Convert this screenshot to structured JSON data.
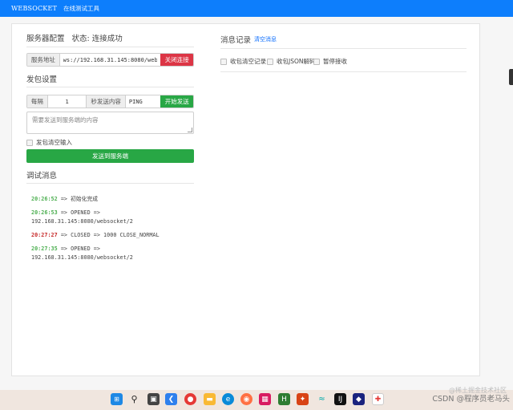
{
  "header": {
    "brand": "WEBSOCKET",
    "subtitle": "在线测试工具"
  },
  "server": {
    "title": "服务器配置",
    "status": "状态: 连接成功",
    "address_label": "服务地址",
    "address_value": "ws://192.168.31.145:8080/websocket/2",
    "disconnect_button": "关闭连接"
  },
  "send": {
    "title": "发包设置",
    "every_label": "每隔",
    "every_value": "1",
    "content_label": "秒发送内容",
    "content_value": "PING",
    "start_button": "开始发送",
    "message_placeholder": "需要发送到服务端的内容",
    "clear_after_send": "发包清空输入",
    "send_button": "发送到服务端"
  },
  "debug": {
    "title": "调试消息",
    "entries": [
      {
        "time": "20:26:52",
        "text": "=> 初始化完成"
      },
      {
        "time": "20:26:53",
        "text": "=> OPENED => 192.168.31.145:8080/websocket/2"
      },
      {
        "time": "20:27:27",
        "text": "=> CLOSED => 1000 CLOSE_NORMAL"
      },
      {
        "time": "20:27:35",
        "text": "=> OPENED => 192.168.31.145:8080/websocket/2"
      }
    ]
  },
  "messages": {
    "title": "消息记录",
    "clear_link": "清空消息",
    "options": [
      "收包清空记录",
      "收包JSON解码",
      "暂停接收"
    ]
  },
  "watermark": {
    "top": "@稀土掘金技术社区",
    "bottom": "CSDN @程序员老马头"
  },
  "colors": {
    "primary": "#0d7efc",
    "danger": "#dc3545",
    "success": "#28a745",
    "log_green": "#4caf50",
    "log_red": "#c62828"
  }
}
